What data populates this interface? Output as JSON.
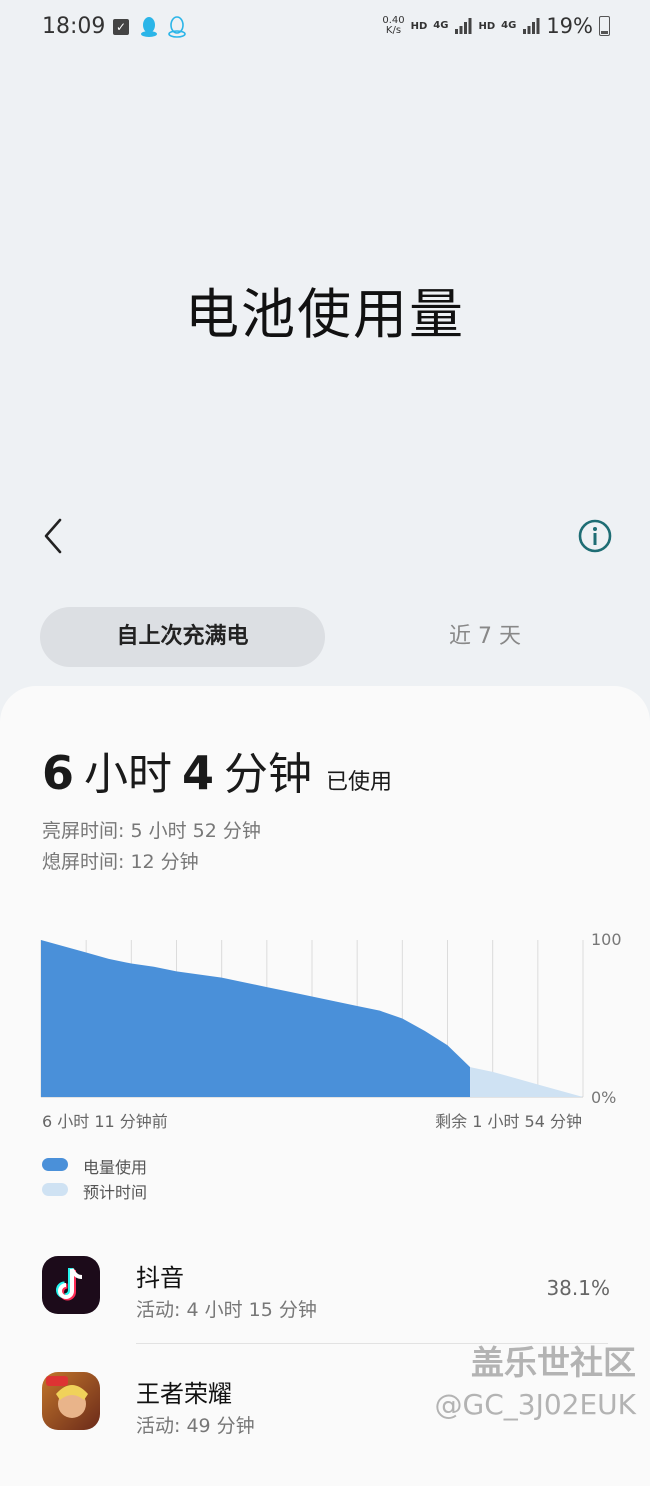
{
  "status_bar": {
    "time": "18:09",
    "net_speed_value": "0.40",
    "net_speed_unit": "K/s",
    "hd1": "HD",
    "net1": "4G",
    "hd2": "HD",
    "net2": "4G",
    "battery_pct": "19%"
  },
  "header": {
    "title": "电池使用量"
  },
  "tabs": [
    {
      "label": "自上次充满电",
      "active": true
    },
    {
      "label": "近 7 天",
      "active": false
    }
  ],
  "summary": {
    "used_hours": "6",
    "hours_unit": "小时",
    "used_minutes": "4",
    "minutes_unit": "分钟",
    "used_suffix": "已使用",
    "screen_on": "亮屏时间:  5 小时 52 分钟",
    "screen_off": "熄屏时间:   12 分钟"
  },
  "chart_data": {
    "type": "area",
    "y_top_label": "100",
    "y_bottom_label": "0%",
    "ylim": [
      0,
      100
    ],
    "x_start_label": "6 小时 11 分钟前",
    "x_end_label": "剩余 1 小时 54 分钟",
    "series": [
      {
        "name": "电量使用",
        "color": "#4a90d9",
        "values": [
          100,
          96,
          92,
          88,
          85,
          83,
          80,
          78,
          76,
          73,
          70,
          67,
          64,
          61,
          58,
          55,
          50,
          42,
          33,
          19
        ]
      },
      {
        "name": "预计时间",
        "color": "#cfe2f3",
        "values": [
          19,
          16,
          12,
          8,
          4,
          0
        ]
      }
    ]
  },
  "apps": [
    {
      "name": "抖音",
      "activity": "活动: 4 小时 15 分钟",
      "pct": "38.1%",
      "icon": "douyin-icon"
    },
    {
      "name": "王者荣耀",
      "activity": "活动: 49 分钟",
      "pct": "",
      "icon": "honor-of-kings-icon"
    }
  ],
  "watermark": {
    "line1": "盖乐世社区",
    "line2": "@GC_3J02EUK"
  }
}
